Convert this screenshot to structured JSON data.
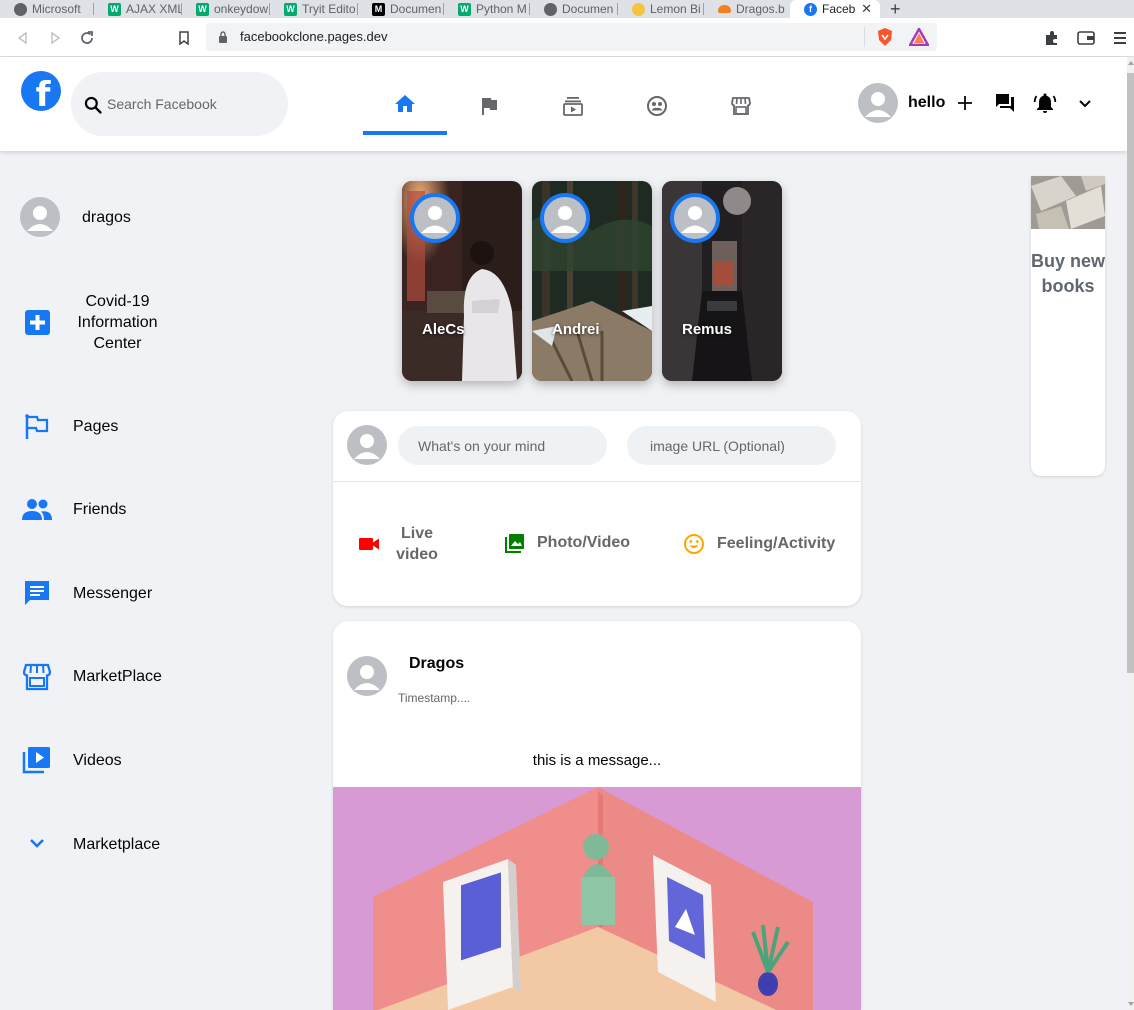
{
  "browser": {
    "tabs": [
      {
        "title": "Microsoft",
        "favicon": "globe-icon"
      },
      {
        "title": "AJAX XML",
        "favicon": "w3-icon"
      },
      {
        "title": "onkeydow",
        "favicon": "w3-icon"
      },
      {
        "title": "Tryit Edito",
        "favicon": "w3-icon"
      },
      {
        "title": "Documen",
        "favicon": "m-icon"
      },
      {
        "title": "Python M",
        "favicon": "w3-icon"
      },
      {
        "title": "Documen",
        "favicon": "globe-icon"
      },
      {
        "title": "Lemon Bi",
        "favicon": "bulb-icon"
      },
      {
        "title": "Dragos.b",
        "favicon": "cloud-icon"
      },
      {
        "title": "Faceb",
        "favicon": "facebook-icon",
        "active": true
      }
    ],
    "url": "facebookclone.pages.dev"
  },
  "header": {
    "logo": "f",
    "search_placeholder": "Search Facebook",
    "nav": [
      {
        "icon": "home-icon",
        "active": true
      },
      {
        "icon": "flag-icon",
        "active": false
      },
      {
        "icon": "subscriptions-icon",
        "active": false
      },
      {
        "icon": "groups-icon",
        "active": false
      },
      {
        "icon": "storefront-icon",
        "active": false
      }
    ],
    "user_name": "hello",
    "right_icons": [
      "add-icon",
      "forum-icon",
      "notifications-icon",
      "expand-more-icon"
    ]
  },
  "sidebar": {
    "items": [
      {
        "label": "dragos",
        "icon": "avatar"
      },
      {
        "label": "Covid-19 Information Center",
        "icon": "local-hospital-icon"
      },
      {
        "label": "Pages",
        "icon": "emoji-flags-icon"
      },
      {
        "label": "Friends",
        "icon": "people-icon"
      },
      {
        "label": "Messenger",
        "icon": "chat-icon"
      },
      {
        "label": "MarketPlace",
        "icon": "storefront-icon"
      },
      {
        "label": "Videos",
        "icon": "video-library-icon"
      },
      {
        "label": "Marketplace",
        "icon": "expand-more-icon"
      }
    ]
  },
  "stories": [
    {
      "name": "AleCs"
    },
    {
      "name": "Andrei"
    },
    {
      "name": "Remus"
    }
  ],
  "composer": {
    "message_placeholder": "What's on your mind",
    "image_placeholder": "image URL (Optional)",
    "options": [
      {
        "label": "Live video",
        "icon": "videocam-icon",
        "color": "#ff0000"
      },
      {
        "label": "Photo/Video",
        "icon": "photo-library-icon",
        "color": "#008000"
      },
      {
        "label": "Feeling/Activity",
        "icon": "insert-emoticon-icon",
        "color": "#ffa500"
      }
    ]
  },
  "post": {
    "author": "Dragos",
    "timestamp": "Timestamp....",
    "message": "this is a message..."
  },
  "ad": {
    "text": "Buy new books"
  },
  "colors": {
    "brand": "#1877f2",
    "background": "#f0f2f5"
  }
}
